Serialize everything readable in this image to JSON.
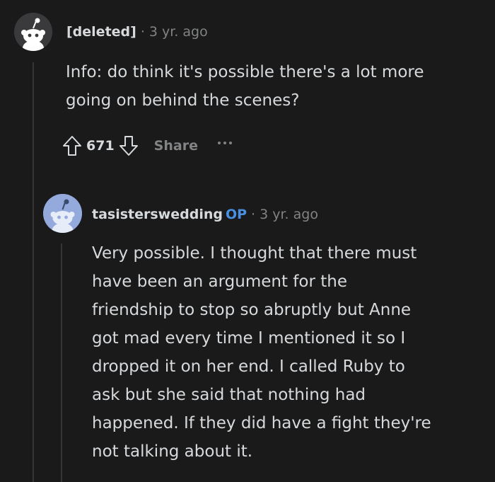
{
  "parent_comment": {
    "author": "[deleted]",
    "separator": "·",
    "age": "3 yr. ago",
    "body_lines": [
      "Info: do think it's possible there's a lot more",
      "going on behind the scenes?"
    ],
    "score": "671",
    "share_label": "Share"
  },
  "reply_comment": {
    "author": "tasisterswedding",
    "op_badge": "OP",
    "separator": "·",
    "age": "3 yr. ago",
    "body_lines": [
      "Very possible. I thought that there must",
      "have been an argument for the",
      "friendship to stop so abruptly but Anne",
      "got mad every time I mentioned it so I",
      "dropped it on her end. I called Ruby to",
      "ask but she said that nothing had",
      "happened. If they did have a fight they're",
      "not talking about it."
    ]
  },
  "icons": {
    "default_avatar": "reddit-snoo-avatar-icon",
    "upvote": "arrow-up-icon",
    "downvote": "arrow-down-icon",
    "more": "more-dots-icon"
  },
  "colors": {
    "background": "#1a1a1b",
    "text": "#d7dadc",
    "muted": "#818384",
    "op_badge": "#4a90e2",
    "reply_avatar_bg": "#94a9dc"
  }
}
